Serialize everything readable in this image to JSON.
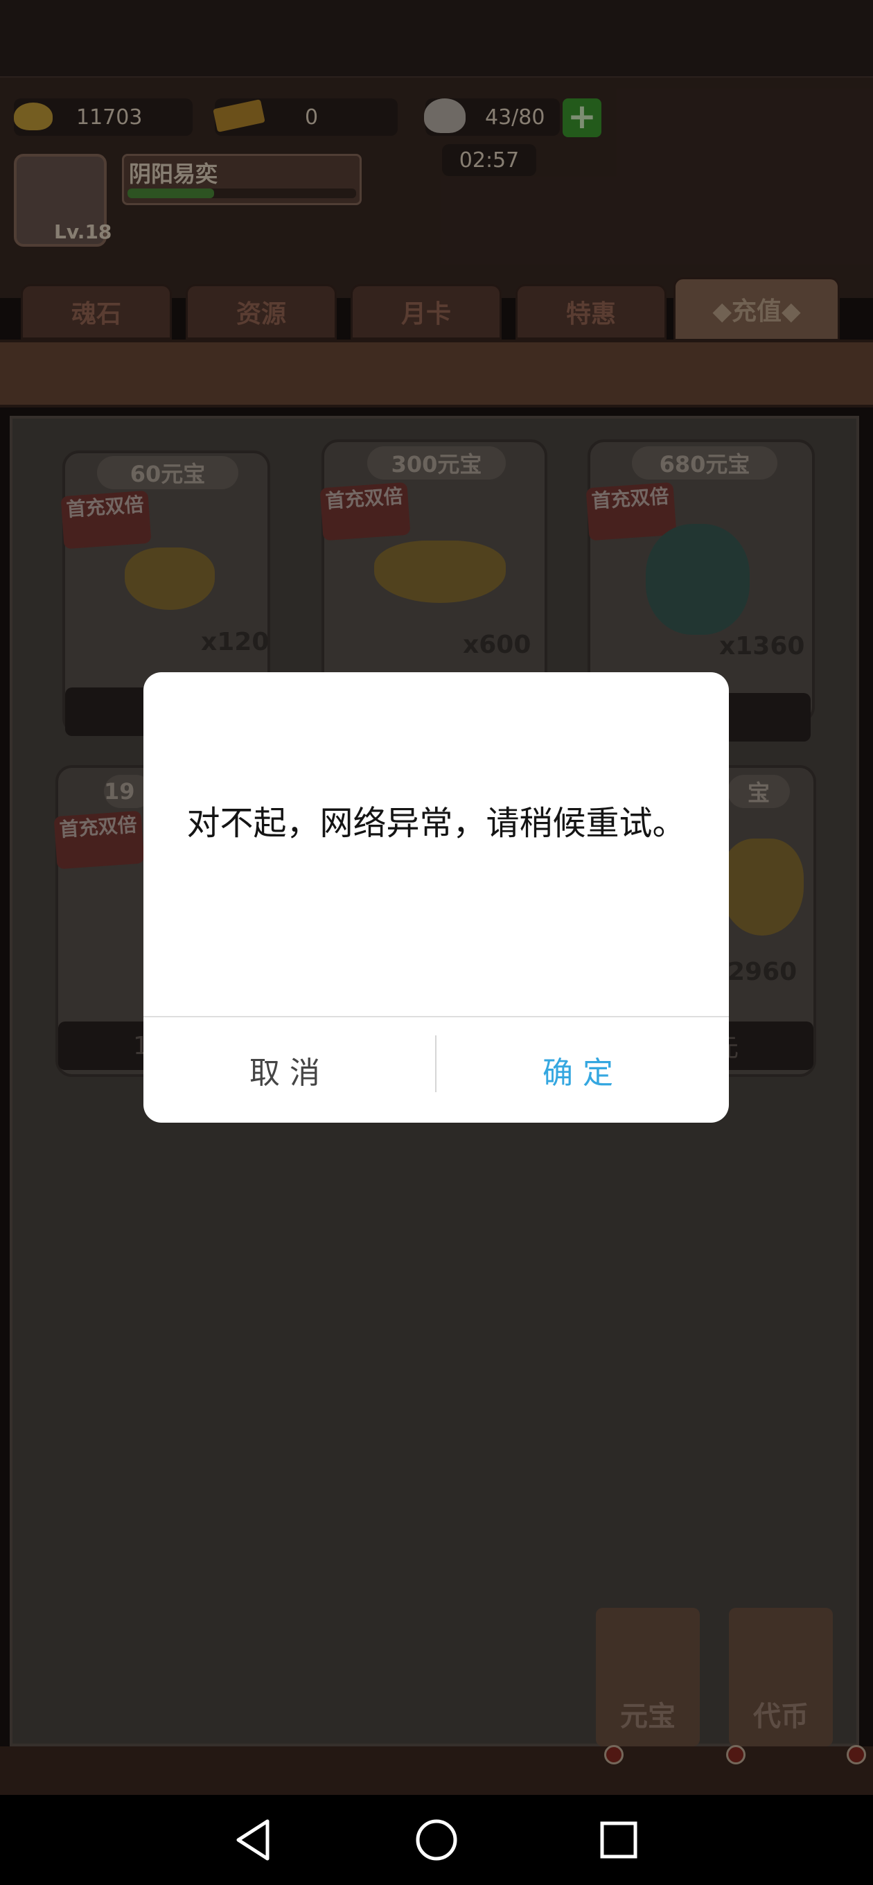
{
  "header": {
    "gold": "11703",
    "tickets": "0",
    "stamina": "43/80",
    "timer": "02:57",
    "player_name": "阴阳易奕",
    "level": "Lv.18",
    "xp_fraction": 0.38
  },
  "tabs": [
    {
      "label": "魂石"
    },
    {
      "label": "资源"
    },
    {
      "label": "月卡"
    },
    {
      "label": "特惠"
    },
    {
      "label": "◆充值◆"
    }
  ],
  "cards": [
    {
      "price": "60元宝",
      "badge": "首充双倍",
      "qty": "x120"
    },
    {
      "price": "300元宝",
      "badge": "首充双倍",
      "qty": "x600"
    },
    {
      "price": "680元宝",
      "badge": "首充双倍",
      "qty": "x1360"
    },
    {
      "price": "19",
      "badge": "首充双倍",
      "btn": "1"
    },
    {
      "price": "宝",
      "qty": "2960",
      "btn": "元"
    }
  ],
  "side_buttons": [
    {
      "label": "元宝"
    },
    {
      "label": "代币"
    }
  ],
  "dialog": {
    "message": "对不起，网络异常，请稍候重试。",
    "cancel_label": "取消",
    "confirm_label": "确定"
  }
}
